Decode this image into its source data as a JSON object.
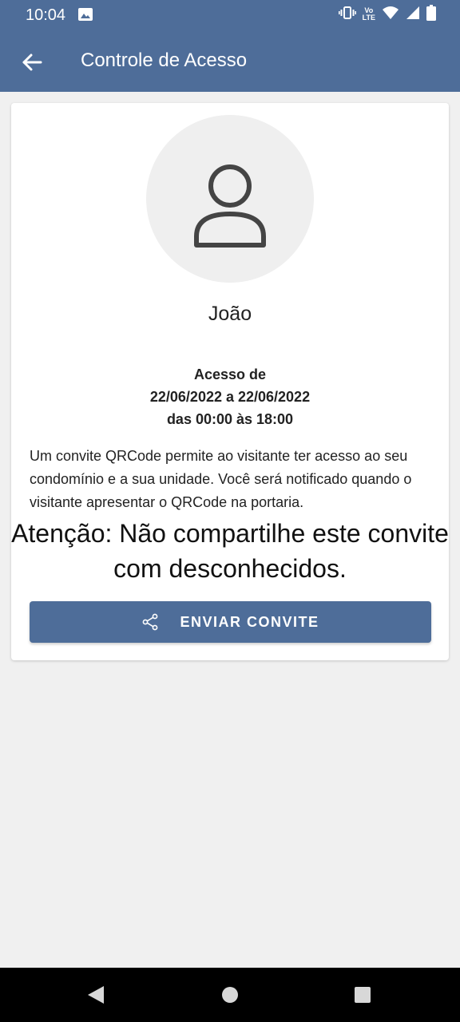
{
  "status_bar": {
    "time": "10:04",
    "volte_top": "Vo",
    "volte_bottom": "LTE",
    "icons": [
      "gallery-icon",
      "vibrate-icon",
      "wifi-icon",
      "signal-icon",
      "battery-icon"
    ]
  },
  "app_bar": {
    "title": "Controle de Acesso",
    "back_icon": "arrow-left-icon",
    "color": "#4e6d99"
  },
  "invite": {
    "avatar_icon": "person-icon",
    "visitor_name": "João",
    "access_label": "Acesso de",
    "date_range": "22/06/2022 a 22/06/2022",
    "time_range": "das 00:00 às 18:00",
    "description": "Um convite QRCode permite ao visitante ter acesso ao seu condomínio e a sua unidade. Você será notificado quando o visitante apresentar o QRCode na portaria.",
    "warning": "Atenção: Não compartilhe este convite com desconhecidos.",
    "send_button_label": "ENVIAR CONVITE",
    "send_button_icon": "share-icon"
  },
  "nav_bar": {
    "icons": [
      "nav-back-icon",
      "nav-home-icon",
      "nav-recents-icon"
    ]
  }
}
